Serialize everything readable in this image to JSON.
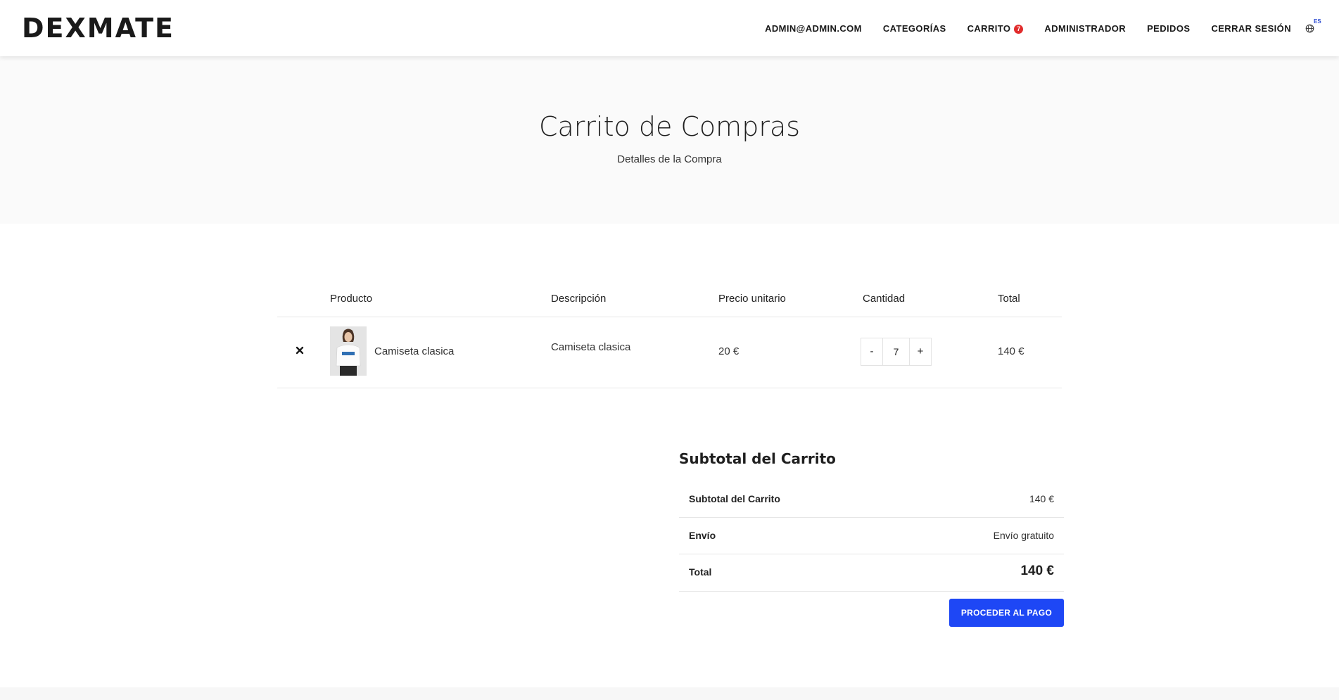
{
  "brand": {
    "logo": "DEXMATE"
  },
  "nav": {
    "items": [
      {
        "label": "ADMIN@ADMIN.COM"
      },
      {
        "label": "CATEGORÍAS"
      },
      {
        "label": "CARRITO",
        "badge": "7"
      },
      {
        "label": "ADMINISTRADOR"
      },
      {
        "label": "PEDIDOS"
      },
      {
        "label": "CERRAR SESIÓN"
      }
    ],
    "language": {
      "icon": "globe-icon",
      "code": "ES"
    }
  },
  "hero": {
    "title": "Carrito de Compras",
    "subtitle": "Detalles de la Compra"
  },
  "cart": {
    "headers": {
      "product": "Producto",
      "description": "Descripción",
      "unit_price": "Precio unitario",
      "quantity": "Cantidad",
      "total": "Total"
    },
    "rows": [
      {
        "name": "Camiseta clasica",
        "description": "Camiseta clasica",
        "unit_price": "20 €",
        "quantity": "7",
        "total": "140 €",
        "remove_icon": "close-icon",
        "minus": "-",
        "plus": "+"
      }
    ]
  },
  "totals": {
    "title": "Subtotal del Carrito",
    "subtotal_label": "Subtotal del Carrito",
    "subtotal_value": "140 €",
    "shipping_label": "Envío",
    "shipping_value": "Envío gratuito",
    "total_label": "Total",
    "total_value": "140 €",
    "checkout_label": "PROCEDER AL PAGO"
  },
  "colors": {
    "accent": "#1e47f5",
    "badge": "#e12c2c",
    "hero_bg": "#fafafa"
  }
}
